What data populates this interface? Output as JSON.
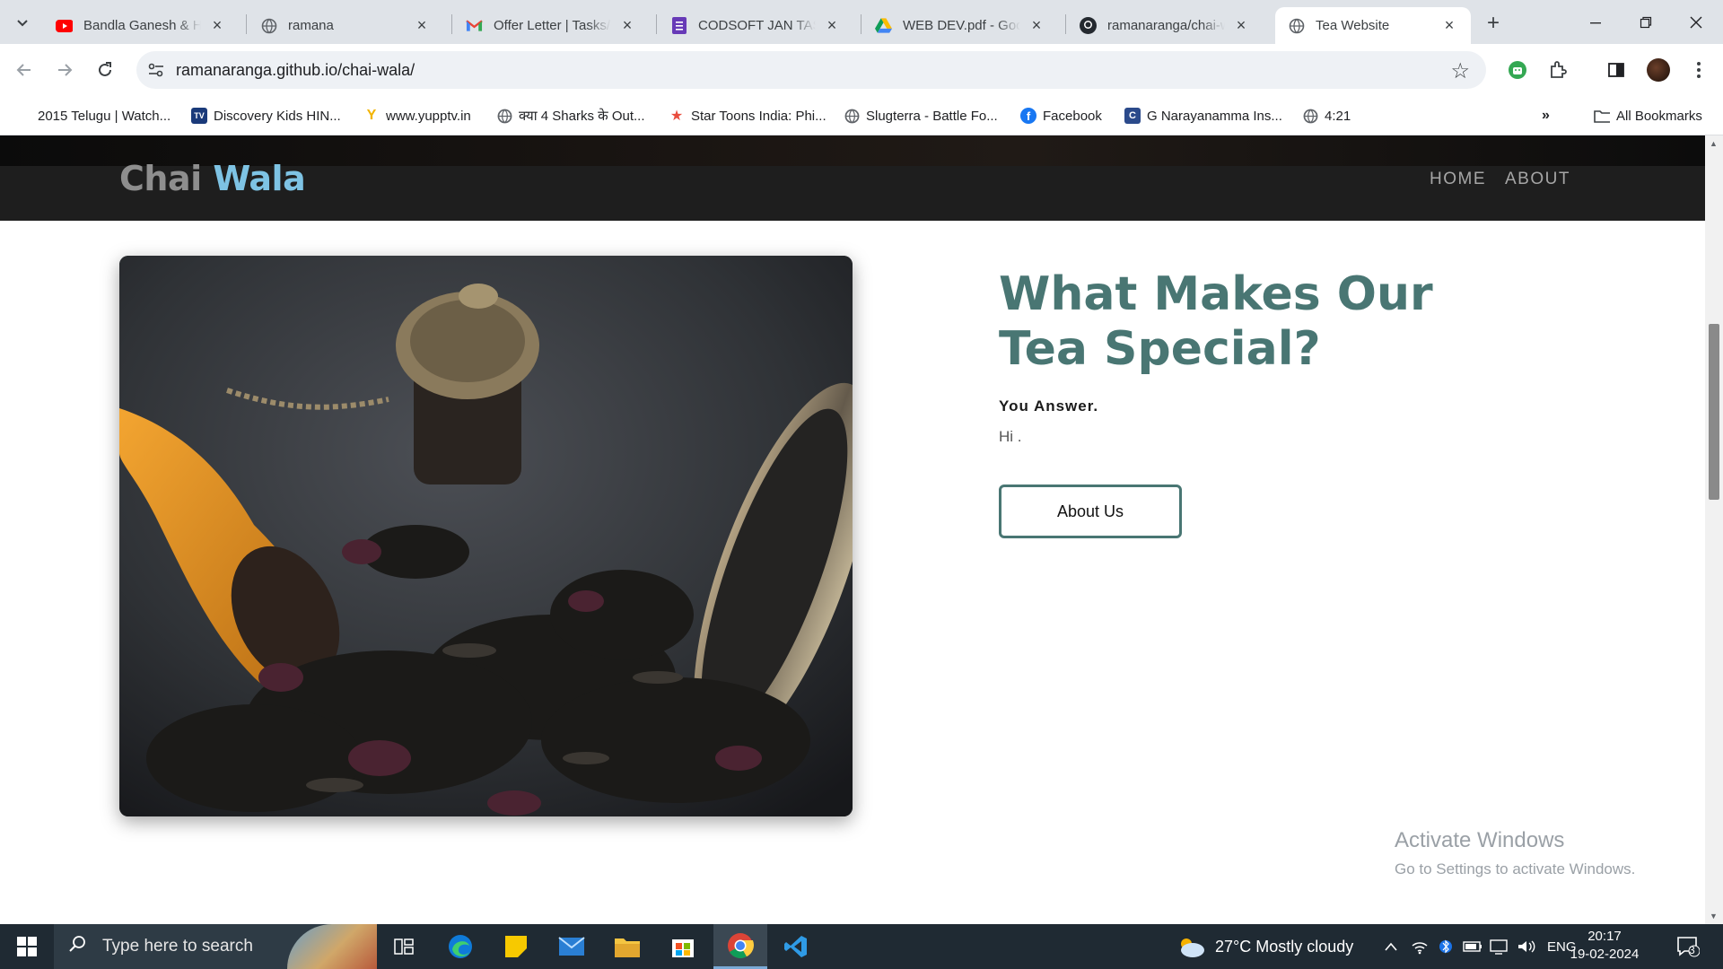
{
  "browser": {
    "tabs": [
      {
        "title": "Bandla Ganesh & His",
        "icon": "youtube-icon"
      },
      {
        "title": "ramana",
        "icon": "globe-icon"
      },
      {
        "title": "Offer Letter | Tasks/P",
        "icon": "gmail-icon"
      },
      {
        "title": "CODSOFT JAN TASK",
        "icon": "forms-icon"
      },
      {
        "title": "WEB DEV.pdf - Goog",
        "icon": "drive-icon"
      },
      {
        "title": "ramanaranga/chai-w",
        "icon": "github-icon"
      },
      {
        "title": "Tea Website",
        "icon": "globe-icon"
      }
    ],
    "url": "ramanaranga.github.io/chai-wala/",
    "bookmarks": [
      {
        "label": "2015 Telugu | Watch...",
        "icon": "none"
      },
      {
        "label": "Discovery Kids HIN...",
        "icon": "tv-icon"
      },
      {
        "label": "www.yupptv.in",
        "icon": "yupptv-icon"
      },
      {
        "label": "क्या 4 Sharks के Out...",
        "icon": "globe-icon"
      },
      {
        "label": "Star Toons India: Phi...",
        "icon": "star-icon"
      },
      {
        "label": "Slugterra - Battle Fo...",
        "icon": "globe-icon"
      },
      {
        "label": "Facebook",
        "icon": "facebook-icon"
      },
      {
        "label": "G Narayanamma Ins...",
        "icon": "college-icon"
      },
      {
        "label": "4:21",
        "icon": "globe-icon"
      }
    ],
    "all_bookmarks": "All Bookmarks"
  },
  "site": {
    "brand_first": "Chai",
    "brand_second": "Wala",
    "nav": [
      "HOME",
      "ABOUT"
    ],
    "section_title": "What Makes Our Tea Special?",
    "section_sub": "You Answer.",
    "section_body": "Hi .",
    "cta": "About Us"
  },
  "watermark": {
    "title": "Activate Windows",
    "subtitle": "Go to Settings to activate Windows."
  },
  "taskbar": {
    "search_placeholder": "Type here to search",
    "weather": "27°C  Mostly cloudy",
    "language": "ENG",
    "time": "20:17",
    "date": "19-02-2024",
    "notifications": "3"
  },
  "colors": {
    "brand_grey": "#8e8e8e",
    "brand_blue": "#7ec3e4",
    "accent_teal": "#497673",
    "header_bg": "#1e1e1e"
  }
}
